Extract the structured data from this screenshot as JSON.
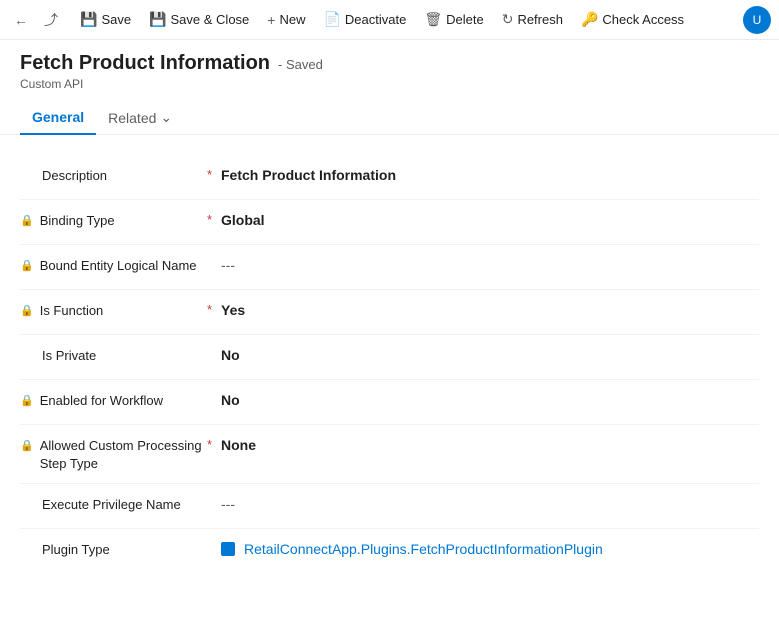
{
  "toolbar": {
    "back_icon": "←",
    "forward_icon": "⤴",
    "save_label": "Save",
    "save_close_label": "Save & Close",
    "new_label": "New",
    "deactivate_label": "Deactivate",
    "delete_label": "Delete",
    "refresh_label": "Refresh",
    "check_access_label": "Check Access",
    "user_initials": "U"
  },
  "page": {
    "title": "Fetch Product Information",
    "saved_badge": "- Saved",
    "subtitle": "Custom API"
  },
  "tabs": {
    "general_label": "General",
    "related_label": "Related"
  },
  "form": {
    "fields": [
      {
        "id": "description",
        "label": "Description",
        "required": true,
        "locked": false,
        "value": "Fetch Product Information",
        "value_type": "bold",
        "empty": false
      },
      {
        "id": "binding_type",
        "label": "Binding Type",
        "required": true,
        "locked": true,
        "value": "Global",
        "value_type": "bold",
        "empty": false
      },
      {
        "id": "bound_entity_logical_name",
        "label": "Bound Entity Logical Name",
        "required": false,
        "locked": true,
        "value": "---",
        "value_type": "empty",
        "empty": true
      },
      {
        "id": "is_function",
        "label": "Is Function",
        "required": true,
        "locked": true,
        "value": "Yes",
        "value_type": "bold",
        "empty": false
      },
      {
        "id": "is_private",
        "label": "Is Private",
        "required": false,
        "locked": false,
        "value": "No",
        "value_type": "bold",
        "empty": false
      },
      {
        "id": "enabled_for_workflow",
        "label": "Enabled for Workflow",
        "required": false,
        "locked": true,
        "value": "No",
        "value_type": "bold",
        "empty": false
      },
      {
        "id": "allowed_custom_processing",
        "label": "Allowed Custom Processing Step Type",
        "required": true,
        "locked": true,
        "value": "None",
        "value_type": "bold",
        "empty": false
      },
      {
        "id": "execute_privilege_name",
        "label": "Execute Privilege Name",
        "required": false,
        "locked": false,
        "value": "---",
        "value_type": "empty",
        "empty": true
      },
      {
        "id": "plugin_type",
        "label": "Plugin Type",
        "required": false,
        "locked": false,
        "value": "RetailConnectApp.Plugins.FetchProductInformationPlugin",
        "value_type": "link",
        "empty": false
      }
    ]
  }
}
